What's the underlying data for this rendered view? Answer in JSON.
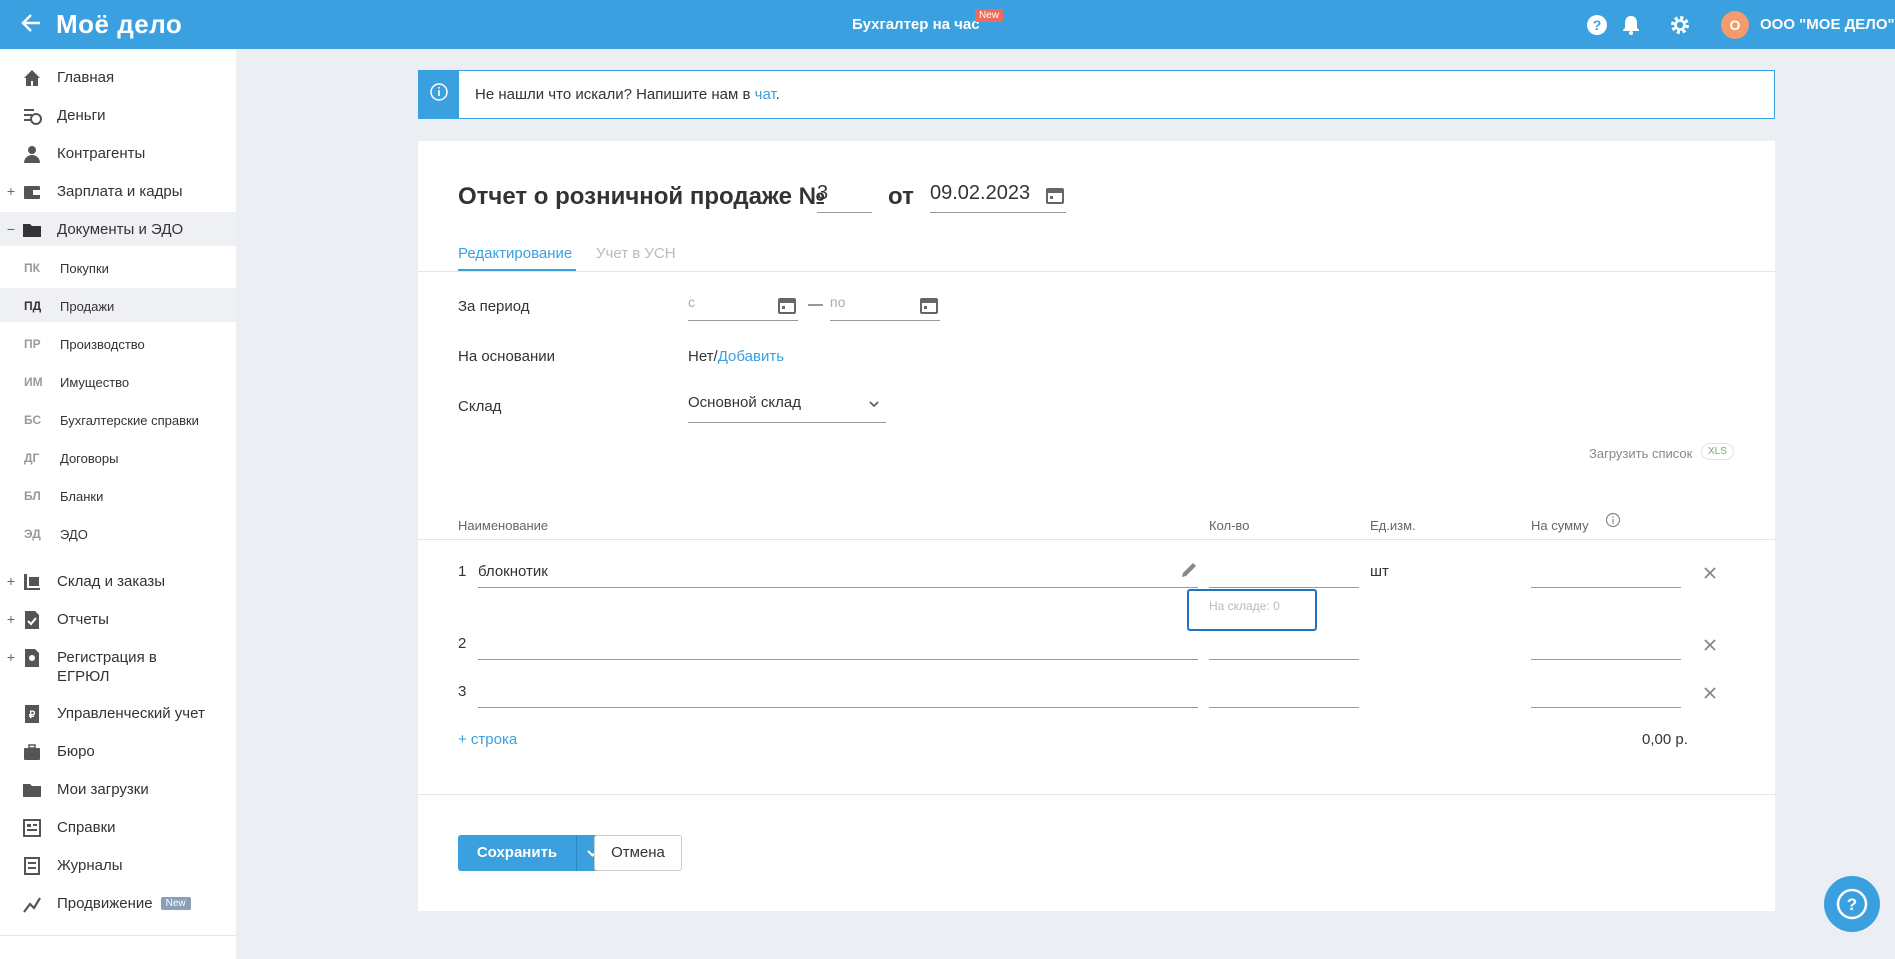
{
  "header": {
    "logo": "Моё дело",
    "center_title": "Бухгалтер на час",
    "center_badge": "New",
    "avatar_letter": "О",
    "org_name": "ООО \"МОЕ ДЕЛО\""
  },
  "sidebar": {
    "items": [
      {
        "label": "Главная"
      },
      {
        "label": "Деньги"
      },
      {
        "label": "Контрагенты"
      },
      {
        "label": "Зарплата и кадры",
        "expander": "+"
      },
      {
        "label": "Документы и ЭДО",
        "expander": "−"
      },
      {
        "label": "Склад и заказы",
        "expander": "+"
      },
      {
        "label": "Отчеты",
        "expander": "+"
      },
      {
        "label": "Регистрация в",
        "label2": "ЕГРЮЛ",
        "expander": "+"
      },
      {
        "label": "Управленческий учет"
      },
      {
        "label": "Бюро"
      },
      {
        "label": "Мои загрузки"
      },
      {
        "label": "Справки"
      },
      {
        "label": "Журналы"
      },
      {
        "label": "Продвижение",
        "badge": "New"
      }
    ],
    "subitems": [
      {
        "abbr": "ПК",
        "label": "Покупки"
      },
      {
        "abbr": "ПД",
        "label": "Продажи"
      },
      {
        "abbr": "ПР",
        "label": "Производство"
      },
      {
        "abbr": "ИМ",
        "label": "Имущество"
      },
      {
        "abbr": "БС",
        "label": "Бухгалтерские справки"
      },
      {
        "abbr": "ДГ",
        "label": "Договоры"
      },
      {
        "abbr": "БЛ",
        "label": "Бланки"
      },
      {
        "abbr": "ЭД",
        "label": "ЭДО"
      }
    ]
  },
  "info": {
    "text": "Не нашли что искали? Напишите нам в ",
    "link": "чат",
    "tail": "."
  },
  "document": {
    "title": "Отчет о розничной продаже №",
    "number": "3",
    "from_label": "от",
    "date": "09.02.2023",
    "tabs": [
      "Редактирование",
      "Учет в УСН"
    ],
    "period_label": "За период",
    "period_from_placeholder": "с",
    "period_to_placeholder": "по",
    "period_dash": "—",
    "basis_label": "На основании",
    "basis_value": "Нет/",
    "basis_link": "Добавить",
    "warehouse_label": "Склад",
    "warehouse_value": "Основной склад",
    "upload_label": "Загрузить список",
    "upload_badge": "XLS"
  },
  "table": {
    "columns": [
      "Наименование",
      "Кол-во",
      "Ед.изм.",
      "На сумму"
    ],
    "rows": [
      {
        "n": "1",
        "name": "блокнотик",
        "qty": "",
        "unit": "шт",
        "sum": ""
      },
      {
        "n": "2",
        "name": "",
        "qty": "",
        "unit": "",
        "sum": ""
      },
      {
        "n": "3",
        "name": "",
        "qty": "",
        "unit": "",
        "sum": ""
      }
    ],
    "stock_hint": "На складе: 0",
    "add_row": "+ строка",
    "total": "0,00 р."
  },
  "actions": {
    "save": "Сохранить",
    "cancel": "Отмена"
  },
  "colors": {
    "accent": "#3aa0df",
    "badge_new": "#f06a5b"
  }
}
